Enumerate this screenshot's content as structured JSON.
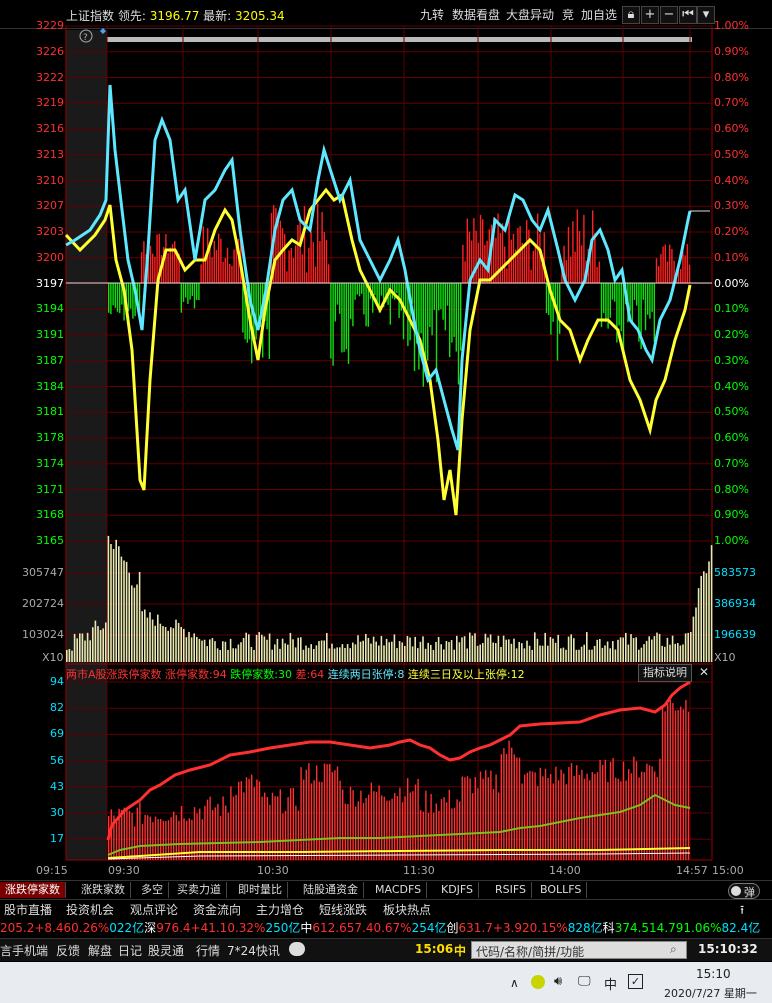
{
  "header": {
    "index_name": "上证指数",
    "lead_label": "领先:",
    "lead_value": "3196.77",
    "latest_label": "最新:",
    "latest_value": "3205.34",
    "buttons": [
      "九转",
      "数据看盘",
      "大盘异动",
      "竞",
      "加自选"
    ],
    "icons": [
      "lock-icon",
      "plus-icon",
      "minus-icon",
      "first-page-icon",
      "dropdown-icon"
    ]
  },
  "price_axis": {
    "left": [
      "3229",
      "3226",
      "3222",
      "3219",
      "3216",
      "3213",
      "3210",
      "3207",
      "3203",
      "3200",
      "3197",
      "3194",
      "3191",
      "3187",
      "3184",
      "3181",
      "3178",
      "3174",
      "3171",
      "3168",
      "3165"
    ],
    "right": [
      "1.00%",
      "0.90%",
      "0.80%",
      "0.70%",
      "0.60%",
      "0.50%",
      "0.40%",
      "0.30%",
      "0.20%",
      "0.10%",
      "0.00%",
      "0.10%",
      "0.20%",
      "0.30%",
      "0.40%",
      "0.50%",
      "0.60%",
      "0.70%",
      "0.80%",
      "0.90%",
      "1.00%"
    ]
  },
  "volume_axis": {
    "left": [
      "305747",
      "202724",
      "103024"
    ],
    "left_unit": "X10",
    "right": [
      "583573",
      "386934",
      "196639"
    ],
    "right_unit": "X10"
  },
  "limit_panel": {
    "title": "两市A股涨跌停家数",
    "up_limit_label": "涨停家数:",
    "up_limit_value": "94",
    "down_limit_label": "跌停家数:",
    "down_limit_value": "30",
    "diff_label": "差:",
    "diff_value": "64",
    "two_day_label": "连续两日张停:",
    "two_day_value": "8",
    "three_day_label": "连续三日及以上张停:",
    "three_day_value": "12",
    "help_label": "指标说明",
    "axis": [
      "94",
      "82",
      "69",
      "56",
      "43",
      "30",
      "17"
    ]
  },
  "time_axis": [
    "09:15",
    "09:30",
    "10:30",
    "11:30",
    "14:00",
    "14:57",
    "15:00"
  ],
  "indicator_tabs": [
    "涨跌停家数",
    "涨跌家数",
    "多空",
    "买卖力道",
    "即时量比",
    "陆股通资金",
    "MACDFS",
    "KDJFS",
    "RSIFS",
    "BOLLFS"
  ],
  "toggle_label": "弹",
  "service_tabs": [
    "股市直播",
    "投资机会",
    "观点评论",
    "资金流向",
    "主力增仓",
    "短线涨跌",
    "板块热点"
  ],
  "ticker": {
    "segments": [
      {
        "text": "205.2",
        "color": "#ff3030"
      },
      {
        "text": "+8.46",
        "color": "#ff3030"
      },
      {
        "text": "0.26%",
        "color": "#ff3030"
      },
      {
        "text": "022亿",
        "color": "#00e0ff"
      },
      {
        "text": "深",
        "color": "#ffffff"
      },
      {
        "text": "976.4",
        "color": "#ff3030"
      },
      {
        "text": "+41.1",
        "color": "#ff3030"
      },
      {
        "text": "0.32%",
        "color": "#ff3030"
      },
      {
        "text": "250亿",
        "color": "#00e0ff"
      },
      {
        "text": "中",
        "color": "#ffffff"
      },
      {
        "text": "612.6",
        "color": "#ff3030"
      },
      {
        "text": "57.4",
        "color": "#ff3030"
      },
      {
        "text": "0.67%",
        "color": "#ff3030"
      },
      {
        "text": "254亿",
        "color": "#00e0ff"
      },
      {
        "text": "创",
        "color": "#ffffff"
      },
      {
        "text": "631.7",
        "color": "#ff3030"
      },
      {
        "text": "+3.92",
        "color": "#ff3030"
      },
      {
        "text": "0.15%",
        "color": "#ff3030"
      },
      {
        "text": "828亿",
        "color": "#00e0ff"
      },
      {
        "text": "科",
        "color": "#ffffff"
      },
      {
        "text": "374.5",
        "color": "#00ff00"
      },
      {
        "text": "14.79",
        "color": "#00ff00"
      },
      {
        "text": "1.06%",
        "color": "#00ff00"
      },
      {
        "text": "82.4亿",
        "color": "#00e0ff"
      }
    ]
  },
  "bottom_bar": {
    "items": [
      "言",
      "手机端",
      "反馈",
      "解盘",
      "日记",
      "股灵通",
      "行情",
      "7*24快讯"
    ],
    "time": "15:06",
    "time_suffix": "中",
    "search_placeholder": "代码/名称/简拼/功能",
    "clock": "15:10:32"
  },
  "taskbar": {
    "ime": "中",
    "time": "15:10",
    "date": "2020/7/27 星期一"
  },
  "colors": {
    "up": "#ff3030",
    "down": "#00ff00",
    "index_line": "#5ee8ff",
    "avg_line": "#ffff33",
    "grid": "#7a0000",
    "volume": "#e8e8b0"
  }
}
